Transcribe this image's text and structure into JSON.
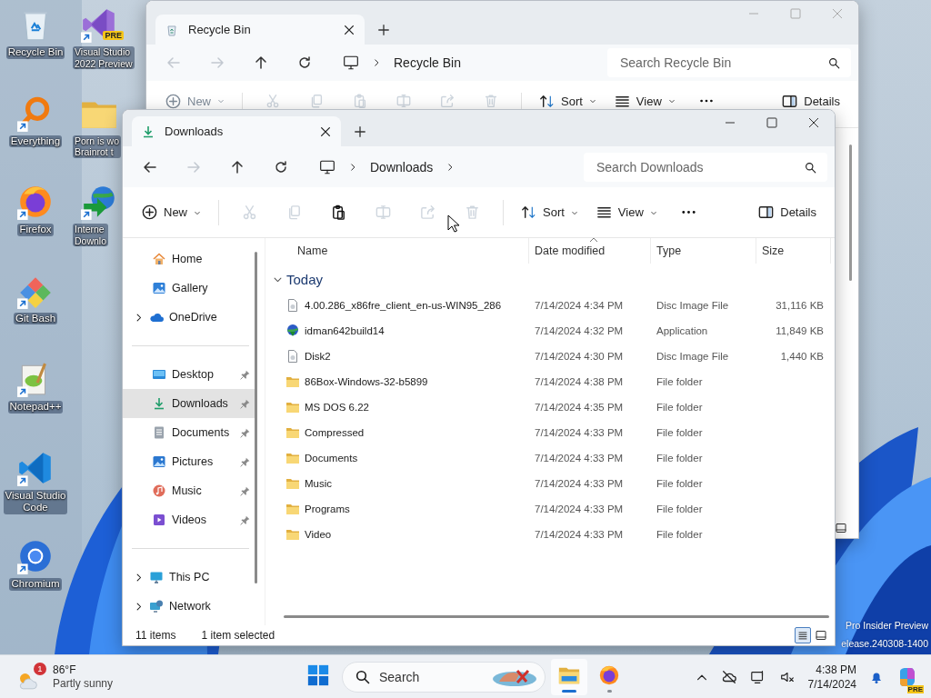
{
  "desktop": {
    "icons": [
      {
        "kind": "recycle-bin",
        "lines": [
          "Recycle Bin"
        ],
        "shortcut": false
      },
      {
        "kind": "everything",
        "lines": [
          "Everything"
        ],
        "shortcut": true
      },
      {
        "kind": "firefox",
        "lines": [
          "Firefox"
        ],
        "shortcut": true
      },
      {
        "kind": "git",
        "lines": [
          "Git Bash"
        ],
        "shortcut": true
      },
      {
        "kind": "notepad",
        "lines": [
          "Notepad++"
        ],
        "shortcut": true
      },
      {
        "kind": "vscode",
        "lines": [
          "Visual Studio",
          "Code"
        ],
        "shortcut": true
      },
      {
        "kind": "chromium",
        "lines": [
          "Chromium"
        ],
        "shortcut": true
      },
      {
        "kind": "vs-preview",
        "lines": [
          "Visual Studio",
          "2022 Preview"
        ],
        "shortcut": true,
        "badge": "PRE"
      },
      {
        "kind": "folder",
        "lines": [
          "Porn is wo",
          "Brainrot t"
        ],
        "shortcut": false
      },
      {
        "kind": "idm",
        "lines": [
          "Interne",
          "Downlo"
        ],
        "shortcut": true
      }
    ],
    "watermark": [
      "Pro Insider Preview",
      "elease.240308-1400"
    ]
  },
  "background_window": {
    "tabs": [
      {
        "title": "Recycle Bin",
        "kind": "recycle-bin",
        "selected": true
      }
    ],
    "nav": [
      {
        "kind": "back",
        "disabled": true
      },
      {
        "kind": "forward",
        "disabled": true
      },
      {
        "kind": "up",
        "disabled": false
      },
      {
        "kind": "refresh",
        "disabled": false
      }
    ],
    "breadcrumb": [
      "Recycle Bin"
    ],
    "trailing_chevron": false,
    "search": {
      "placeholder": "Search Recycle Bin"
    },
    "toolbar": [
      {
        "kind": "new",
        "label": "New",
        "disabled": true
      },
      {
        "kind": "separator"
      },
      {
        "kind": "cut",
        "disabled": true
      },
      {
        "kind": "copy",
        "disabled": true
      },
      {
        "kind": "paste",
        "disabled": true
      },
      {
        "kind": "rename",
        "disabled": true
      },
      {
        "kind": "share",
        "disabled": true
      },
      {
        "kind": "delete",
        "disabled": true
      },
      {
        "kind": "separator"
      },
      {
        "kind": "sort",
        "label": "Sort",
        "disabled": false
      },
      {
        "kind": "view",
        "label": "View",
        "disabled": false
      },
      {
        "kind": "more",
        "disabled": false
      },
      {
        "kind": "details",
        "label": "Details",
        "disabled": false
      }
    ],
    "status": {
      "views": [
        {
          "kind": "tiles",
          "selected": false
        }
      ]
    }
  },
  "window": {
    "tabs": [
      {
        "title": "Downloads",
        "kind": "downloads",
        "selected": true
      }
    ],
    "nav": [
      {
        "kind": "back",
        "disabled": false
      },
      {
        "kind": "forward",
        "disabled": true
      },
      {
        "kind": "up",
        "disabled": false
      },
      {
        "kind": "refresh",
        "disabled": false
      }
    ],
    "breadcrumb": [
      "Downloads"
    ],
    "trailing_chevron": true,
    "search": {
      "placeholder": "Search Downloads"
    },
    "toolbar": [
      {
        "kind": "new",
        "label": "New",
        "disabled": false
      },
      {
        "kind": "separator"
      },
      {
        "kind": "cut",
        "disabled": true
      },
      {
        "kind": "copy",
        "disabled": true
      },
      {
        "kind": "paste",
        "disabled": false
      },
      {
        "kind": "rename",
        "disabled": true
      },
      {
        "kind": "share",
        "disabled": true
      },
      {
        "kind": "delete",
        "disabled": true
      },
      {
        "kind": "separator"
      },
      {
        "kind": "sort",
        "label": "Sort",
        "disabled": false
      },
      {
        "kind": "view",
        "label": "View",
        "disabled": false
      },
      {
        "kind": "more",
        "disabled": false
      },
      {
        "kind": "details",
        "label": "Details",
        "disabled": false
      }
    ],
    "sidebar": {
      "groups": [
        [
          {
            "label": "Home",
            "kind": "home",
            "expandable": false,
            "pinned": false,
            "selected": false
          },
          {
            "label": "Gallery",
            "kind": "gallery",
            "expandable": false,
            "pinned": false,
            "selected": false
          },
          {
            "label": "OneDrive",
            "kind": "onedrive",
            "expandable": true,
            "pinned": false,
            "selected": false
          }
        ],
        [
          {
            "label": "Desktop",
            "kind": "desktop",
            "expandable": false,
            "pinned": true,
            "selected": false
          },
          {
            "label": "Downloads",
            "kind": "downloads",
            "expandable": false,
            "pinned": true,
            "selected": true
          },
          {
            "label": "Documents",
            "kind": "documents",
            "expandable": false,
            "pinned": true,
            "selected": false
          },
          {
            "label": "Pictures",
            "kind": "pictures",
            "expandable": false,
            "pinned": true,
            "selected": false
          },
          {
            "label": "Music",
            "kind": "music",
            "expandable": false,
            "pinned": true,
            "selected": false
          },
          {
            "label": "Videos",
            "kind": "videos",
            "expandable": false,
            "pinned": true,
            "selected": false
          }
        ],
        [
          {
            "label": "This PC",
            "kind": "thispc",
            "expandable": true,
            "pinned": false,
            "selected": false
          },
          {
            "label": "Network",
            "kind": "network",
            "expandable": true,
            "pinned": false,
            "selected": false
          }
        ]
      ]
    },
    "columns": [
      {
        "label": "Name",
        "sorted": false
      },
      {
        "label": "Date modified",
        "sorted": true
      },
      {
        "label": "Type",
        "sorted": false
      },
      {
        "label": "Size",
        "sorted": false
      }
    ],
    "groups": [
      {
        "label": "Today",
        "expanded": true,
        "rows": [
          {
            "kind": "disc",
            "name": "4.00.286_x86fre_client_en-us-WIN95_286",
            "date": "7/14/2024 4:34 PM",
            "type": "Disc Image File",
            "size": "31,116 KB"
          },
          {
            "kind": "app",
            "name": "idman642build14",
            "date": "7/14/2024 4:32 PM",
            "type": "Application",
            "size": "11,849 KB"
          },
          {
            "kind": "disc",
            "name": "Disk2",
            "date": "7/14/2024 4:30 PM",
            "type": "Disc Image File",
            "size": "1,440 KB"
          },
          {
            "kind": "folder",
            "name": "86Box-Windows-32-b5899",
            "date": "7/14/2024 4:38 PM",
            "type": "File folder"
          },
          {
            "kind": "folder",
            "name": "MS DOS 6.22",
            "date": "7/14/2024 4:35 PM",
            "type": "File folder"
          },
          {
            "kind": "folder",
            "name": "Compressed",
            "date": "7/14/2024 4:33 PM",
            "type": "File folder"
          },
          {
            "kind": "folder",
            "name": "Documents",
            "date": "7/14/2024 4:33 PM",
            "type": "File folder"
          },
          {
            "kind": "folder",
            "name": "Music",
            "date": "7/14/2024 4:33 PM",
            "type": "File folder"
          },
          {
            "kind": "folder",
            "name": "Programs",
            "date": "7/14/2024 4:33 PM",
            "type": "File folder"
          },
          {
            "kind": "folder",
            "name": "Video",
            "date": "7/14/2024 4:33 PM",
            "type": "File folder"
          }
        ]
      }
    ],
    "status": {
      "count": "11 items",
      "selection": "1 item selected",
      "views": [
        {
          "kind": "details",
          "selected": true
        },
        {
          "kind": "tiles",
          "selected": false
        }
      ]
    }
  },
  "taskbar": {
    "weather": {
      "temperature": "86°F",
      "condition": "Partly sunny",
      "badge": "1"
    },
    "search": {
      "placeholder": "Search"
    },
    "apps": [
      {
        "kind": "start",
        "running": false,
        "active": false
      },
      {
        "kind": "explorer",
        "running": true,
        "active": true
      },
      {
        "kind": "firefox",
        "running": true,
        "active": false
      }
    ],
    "clock": {
      "time": "4:38 PM",
      "date": "7/14/2024"
    },
    "copilot": {
      "badge": "PRE"
    }
  }
}
